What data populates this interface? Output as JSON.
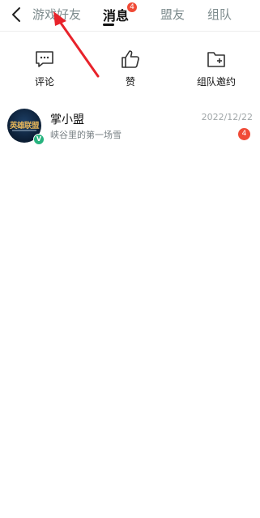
{
  "header": {
    "tabs": [
      {
        "label": "游戏好友"
      },
      {
        "label": "消息",
        "badge": "4"
      },
      {
        "label": "盟友"
      },
      {
        "label": "组队"
      }
    ],
    "active_tab_index": 1
  },
  "actions": [
    {
      "label": "评论",
      "icon": "comment-icon"
    },
    {
      "label": "赞",
      "icon": "thumbs-up-icon"
    },
    {
      "label": "组队邀约",
      "icon": "folder-add-icon"
    }
  ],
  "conversations": [
    {
      "name": "掌小盟",
      "avatar_text": "英雄联盟",
      "verified_mark": "V",
      "preview": "峡谷里的第一场雪",
      "date": "2022/12/22",
      "unread": "4"
    }
  ],
  "colors": {
    "badge": "#f04a36",
    "annotation_arrow": "#e8232b",
    "verified": "#27b37e"
  }
}
